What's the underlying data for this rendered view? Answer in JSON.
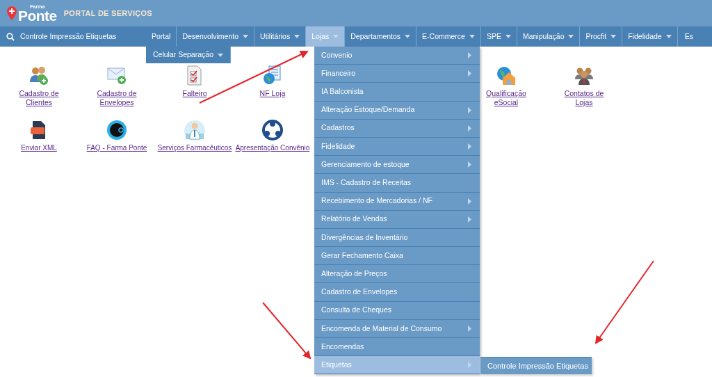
{
  "header": {
    "logo_small": "Farma",
    "logo": "Ponte",
    "title": "PORTAL DE SERVIÇOS"
  },
  "search": {
    "value": "Controle Impressão Etiquetas"
  },
  "nav": [
    {
      "label": "Portal",
      "dropdown": false,
      "selected": false
    },
    {
      "label": "Desenvolvimento",
      "dropdown": true,
      "selected": false
    },
    {
      "label": "Utilitários",
      "dropdown": true,
      "selected": false
    },
    {
      "label": "Lojas",
      "dropdown": true,
      "selected": true
    },
    {
      "label": "Departamentos",
      "dropdown": true,
      "selected": false
    },
    {
      "label": "E-Commerce",
      "dropdown": true,
      "selected": false
    },
    {
      "label": "SPE",
      "dropdown": true,
      "selected": false
    },
    {
      "label": "Manipulação",
      "dropdown": true,
      "selected": false
    },
    {
      "label": "Procfit",
      "dropdown": true,
      "selected": false
    },
    {
      "label": "Fidelidade",
      "dropdown": true,
      "selected": false
    },
    {
      "label": "Es",
      "dropdown": false,
      "selected": false
    }
  ],
  "nav_row2": [
    {
      "label": "Celular Separação",
      "dropdown": true,
      "selected": false
    }
  ],
  "shortcuts_row1": [
    {
      "label": "Cadastro de Clientes",
      "kind": "people-add"
    },
    {
      "label": "Cadastro de Envelopes",
      "kind": "envelope-add"
    },
    {
      "label": "Falteiro",
      "kind": "checklist"
    },
    {
      "label": "NF Loja",
      "kind": "globe-doc"
    },
    {
      "label": "Qualificação eSocial",
      "kind": "globe-house"
    },
    {
      "label": "Contatos de Lojas",
      "kind": "group"
    }
  ],
  "shortcuts_row2": [
    {
      "label": "Enviar XML",
      "kind": "xml"
    },
    {
      "label": "FAQ - Farma Ponte",
      "kind": "faq"
    },
    {
      "label": "Serviços Farmacêuticos",
      "kind": "pharmacist"
    },
    {
      "label": "Apresentação Convênio",
      "kind": "ring"
    }
  ],
  "menu": [
    {
      "label": "Convenio",
      "submenu": true,
      "selected": false
    },
    {
      "label": "Financeiro",
      "submenu": true,
      "selected": false
    },
    {
      "label": "IA Balconista",
      "submenu": false,
      "selected": false
    },
    {
      "label": "Alteração Estoque/Demanda",
      "submenu": true,
      "selected": false
    },
    {
      "label": "Cadastros",
      "submenu": true,
      "selected": false
    },
    {
      "label": "Fidelidade",
      "submenu": true,
      "selected": false
    },
    {
      "label": "Gerenciamento de estoque",
      "submenu": true,
      "selected": false
    },
    {
      "label": "IMS - Cadastro de Receitas",
      "submenu": false,
      "selected": false
    },
    {
      "label": "Recebimento de Mercadorias / NF",
      "submenu": true,
      "selected": false
    },
    {
      "label": "Relatório de Vendas",
      "submenu": true,
      "selected": false
    },
    {
      "label": "Divergências de Inventário",
      "submenu": false,
      "selected": false
    },
    {
      "label": "Gerar Fechamento Caixa",
      "submenu": false,
      "selected": false
    },
    {
      "label": "Alteração de Preços",
      "submenu": false,
      "selected": false
    },
    {
      "label": "Cadastro de Envelopes",
      "submenu": false,
      "selected": false
    },
    {
      "label": "Consulta de Cheques",
      "submenu": false,
      "selected": false
    },
    {
      "label": "Encomenda de Material de Consumo",
      "submenu": true,
      "selected": false
    },
    {
      "label": "Encomendas",
      "submenu": false,
      "selected": false
    },
    {
      "label": "Etiquetas",
      "submenu": true,
      "selected": true
    }
  ],
  "submenu": [
    {
      "label": "Controle Impressão Etiquetas"
    }
  ]
}
